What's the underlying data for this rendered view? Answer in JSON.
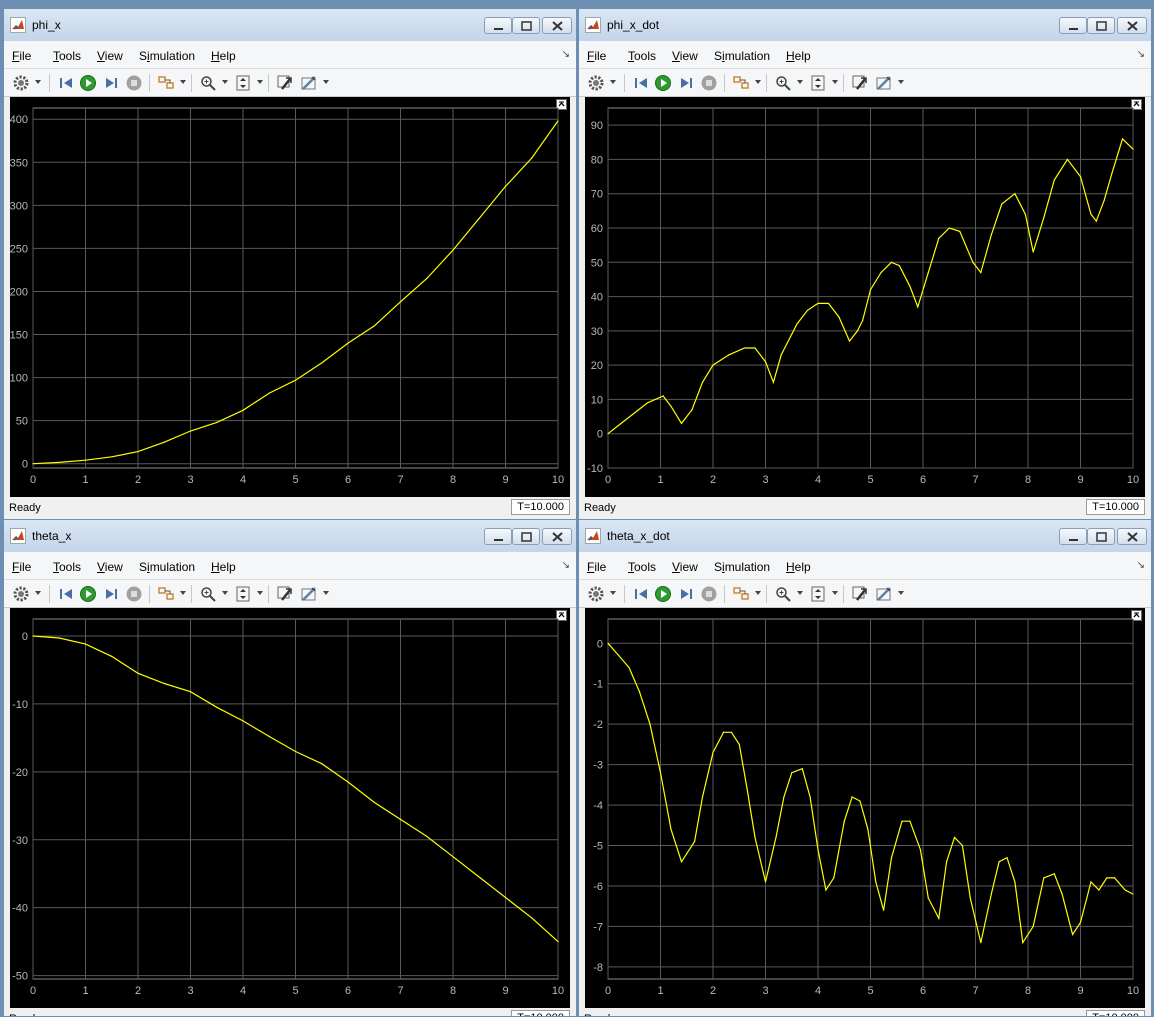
{
  "menu_labels": [
    "File",
    "Tools",
    "View",
    "Simulation",
    "Help"
  ],
  "menu_access_keys": [
    "F",
    "T",
    "V",
    "i",
    "H"
  ],
  "status": {
    "ready": "Ready",
    "time": "T=10.000"
  },
  "colors": {
    "trace": "#ffff00",
    "grid": "#5a5a5a",
    "axes_bg": "#000000",
    "tick_text": "#b8b8b8"
  },
  "toolbar_icons": [
    "gear-icon",
    "step-back-icon",
    "run-icon",
    "step-forward-icon",
    "stop-icon",
    "highlight-icon",
    "zoom-icon",
    "autoscale-icon",
    "restore-icon",
    "cursor-icon"
  ],
  "windows": [
    {
      "title": "phi_x",
      "chart_data": {
        "type": "line",
        "xlim": [
          0,
          10
        ],
        "ylim": [
          -5,
          413
        ],
        "xticks": [
          0,
          1,
          2,
          3,
          4,
          5,
          6,
          7,
          8,
          9,
          10
        ],
        "yticks": [
          0,
          50,
          100,
          150,
          200,
          250,
          300,
          350,
          400
        ],
        "grid": true,
        "x": [
          0,
          0.5,
          1,
          1.5,
          2,
          2.5,
          3,
          3.5,
          4,
          4.5,
          5,
          5.5,
          6,
          6.5,
          7,
          7.5,
          8,
          8.5,
          9,
          9.5,
          10
        ],
        "y": [
          0,
          1.5,
          4,
          8,
          14,
          25,
          38,
          48,
          62,
          82,
          97,
          117,
          140,
          160,
          188,
          215,
          248,
          285,
          322,
          355,
          398
        ]
      }
    },
    {
      "title": "phi_x_dot",
      "chart_data": {
        "type": "line",
        "xlim": [
          0,
          10
        ],
        "ylim": [
          -10,
          95
        ],
        "xticks": [
          0,
          1,
          2,
          3,
          4,
          5,
          6,
          7,
          8,
          9,
          10
        ],
        "yticks": [
          -10,
          0,
          10,
          20,
          30,
          40,
          50,
          60,
          70,
          80,
          90
        ],
        "grid": true,
        "x": [
          0,
          0.25,
          0.5,
          0.75,
          0.9,
          1.05,
          1.2,
          1.4,
          1.6,
          1.8,
          2.0,
          2.3,
          2.6,
          2.8,
          3.0,
          3.15,
          3.3,
          3.6,
          3.8,
          4.0,
          4.2,
          4.4,
          4.6,
          4.75,
          4.85,
          5.0,
          5.2,
          5.4,
          5.55,
          5.75,
          5.9,
          6.1,
          6.3,
          6.5,
          6.7,
          6.95,
          7.1,
          7.3,
          7.5,
          7.75,
          7.95,
          8.1,
          8.3,
          8.5,
          8.75,
          9.0,
          9.2,
          9.3,
          9.45,
          9.6,
          9.8,
          10.0
        ],
        "y": [
          0,
          3,
          6,
          9,
          10,
          11,
          8,
          3,
          7,
          15,
          20,
          23,
          25,
          25,
          21,
          15,
          23,
          32,
          36,
          38,
          38,
          34,
          27,
          30,
          33,
          42,
          47,
          50,
          49,
          43,
          37,
          47,
          57,
          60,
          59,
          50,
          47,
          58,
          67,
          70,
          64,
          53,
          63,
          74,
          80,
          75,
          64,
          62,
          68,
          76,
          86,
          83
        ]
      }
    },
    {
      "title": "theta_x",
      "chart_data": {
        "type": "line",
        "xlim": [
          0,
          10
        ],
        "ylim": [
          -50.5,
          2.5
        ],
        "xticks": [
          0,
          1,
          2,
          3,
          4,
          5,
          6,
          7,
          8,
          9,
          10
        ],
        "yticks": [
          0,
          -10,
          -20,
          -30,
          -40,
          -50
        ],
        "grid": true,
        "x": [
          0,
          0.5,
          1,
          1.5,
          2,
          2.5,
          3,
          3.5,
          4,
          4.5,
          5,
          5.5,
          6,
          6.5,
          7,
          7.5,
          8,
          8.5,
          9,
          9.5,
          10
        ],
        "y": [
          0,
          -0.3,
          -1.2,
          -3,
          -5.5,
          -7,
          -8.2,
          -10.5,
          -12.5,
          -14.8,
          -17,
          -18.8,
          -21.5,
          -24.5,
          -27,
          -29.5,
          -32.5,
          -35.5,
          -38.5,
          -41.5,
          -45
        ]
      }
    },
    {
      "title": "theta_x_dot",
      "chart_data": {
        "type": "line",
        "xlim": [
          0,
          10
        ],
        "ylim": [
          -8.3,
          0.6
        ],
        "xticks": [
          0,
          1,
          2,
          3,
          4,
          5,
          6,
          7,
          8,
          9,
          10
        ],
        "yticks": [
          0,
          -1,
          -2,
          -3,
          -4,
          -5,
          -6,
          -7,
          -8
        ],
        "grid": true,
        "x": [
          0,
          0.2,
          0.4,
          0.6,
          0.8,
          1.0,
          1.2,
          1.4,
          1.5,
          1.65,
          1.8,
          2.0,
          2.2,
          2.35,
          2.5,
          2.65,
          2.8,
          3.0,
          3.2,
          3.35,
          3.5,
          3.7,
          3.85,
          4.0,
          4.15,
          4.3,
          4.5,
          4.65,
          4.8,
          4.95,
          5.1,
          5.25,
          5.4,
          5.6,
          5.75,
          5.95,
          6.1,
          6.3,
          6.45,
          6.6,
          6.75,
          6.9,
          7.1,
          7.3,
          7.45,
          7.6,
          7.75,
          7.9,
          8.1,
          8.3,
          8.5,
          8.65,
          8.85,
          9.0,
          9.2,
          9.35,
          9.5,
          9.65,
          9.85,
          10.0
        ],
        "y": [
          0,
          -0.3,
          -0.6,
          -1.2,
          -2,
          -3.2,
          -4.6,
          -5.4,
          -5.2,
          -4.9,
          -3.8,
          -2.7,
          -2.2,
          -2.2,
          -2.5,
          -3.6,
          -4.8,
          -5.9,
          -4.8,
          -3.8,
          -3.2,
          -3.1,
          -3.8,
          -5.1,
          -6.1,
          -5.8,
          -4.4,
          -3.8,
          -3.9,
          -4.6,
          -5.9,
          -6.6,
          -5.3,
          -4.4,
          -4.4,
          -5.1,
          -6.3,
          -6.8,
          -5.4,
          -4.8,
          -5.0,
          -6.3,
          -7.4,
          -6.2,
          -5.4,
          -5.3,
          -5.9,
          -7.4,
          -7.0,
          -5.8,
          -5.7,
          -6.2,
          -7.2,
          -6.9,
          -5.9,
          -6.1,
          -5.8,
          -5.8,
          -6.1,
          -6.2
        ]
      }
    }
  ]
}
